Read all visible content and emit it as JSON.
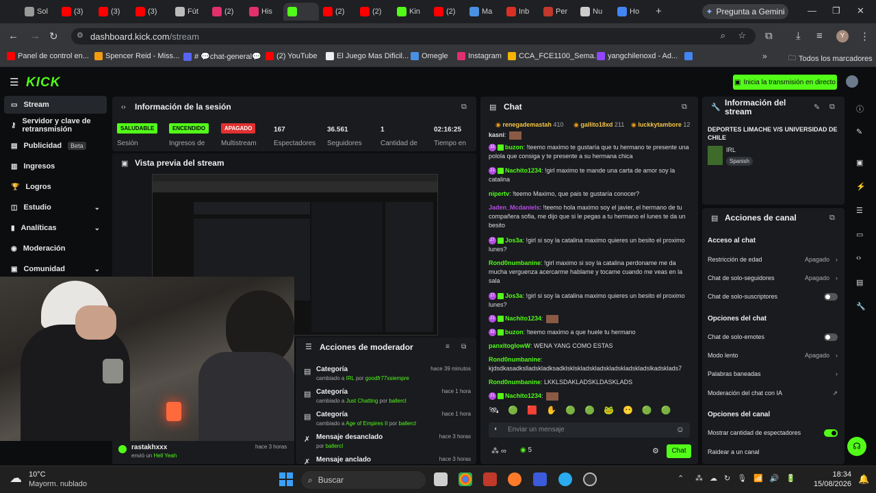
{
  "browser": {
    "tabs": [
      {
        "label": "Sol",
        "color": "#999"
      },
      {
        "label": "(3)",
        "color": "#ff0000"
      },
      {
        "label": "(3)",
        "color": "#ff0000"
      },
      {
        "label": "(3)",
        "color": "#ff0000"
      },
      {
        "label": "Fút",
        "color": "#bbb"
      },
      {
        "label": "(2)",
        "color": "#e1306c"
      },
      {
        "label": "His",
        "color": "#e1306c"
      },
      {
        "label": "",
        "color": "#53fc18"
      },
      {
        "label": "(2)",
        "color": "#ff0000"
      },
      {
        "label": "(2)",
        "color": "#ff0000"
      },
      {
        "label": "Kin",
        "color": "#53fc18"
      },
      {
        "label": "(2)",
        "color": "#ff0000"
      },
      {
        "label": "Ma",
        "color": "#4a90e2"
      },
      {
        "label": "Inb",
        "color": "#d93025"
      },
      {
        "label": "Per",
        "color": "#c0392b"
      },
      {
        "label": "Nu",
        "color": "#ccc"
      },
      {
        "label": "Ho",
        "color": "#4285f4"
      }
    ],
    "gemini": "Pregunta a Gemini",
    "url_host": "dashboard.kick.com",
    "url_path": "/stream",
    "avatar": "Y",
    "bookmarks": [
      {
        "label": "Panel de control en...",
        "color": "#ff0000"
      },
      {
        "label": "Spencer Reid - Miss...",
        "color": "#f39c12"
      },
      {
        "label": "# 💬chat-general💬",
        "color": "#5865f2"
      },
      {
        "label": "(2) YouTube",
        "color": "#ff0000"
      },
      {
        "label": "El Juego Mas Dificil...",
        "color": "#eee"
      },
      {
        "label": "Omegle",
        "color": "#4a90e2"
      },
      {
        "label": "Instagram",
        "color": "#e1306c"
      },
      {
        "label": "CCA_FCE1100_Sema...",
        "color": "#f4b400"
      },
      {
        "label": "yangchilenoxd - Ad...",
        "color": "#9146ff"
      },
      {
        "label": "",
        "color": "#4285f4"
      }
    ],
    "all_bookmarks": "Todos los marcadores"
  },
  "kick": {
    "logo": "KICK",
    "go_live": "Inicia la transmisión en directo",
    "sidebar": [
      {
        "label": "Stream",
        "active": true
      },
      {
        "label": "Servidor y clave de retransmisión"
      },
      {
        "label": "Publicidad",
        "beta": "Beta"
      },
      {
        "label": "Ingresos"
      },
      {
        "label": "Logros"
      },
      {
        "label": "Estudio",
        "chev": true
      },
      {
        "label": "Analíticas",
        "chev": true
      },
      {
        "label": "Moderación"
      },
      {
        "label": "Comunidad",
        "chev": true
      }
    ],
    "session": {
      "title": "Información de la sesión",
      "badges": [
        {
          "text": "SALUDABLE",
          "label": "Sesión",
          "color": "#53fc18",
          "fg": "#0b0d0f"
        },
        {
          "text": "ENCENDIDO",
          "label": "Ingresos de",
          "color": "#53fc18",
          "fg": "#0b0d0f"
        },
        {
          "text": "APAGADO",
          "label": "Multistream",
          "color": "#e03131",
          "fg": "#ffffff"
        }
      ],
      "stats": [
        {
          "value": "167",
          "label": "Espectadores"
        },
        {
          "value": "36.561",
          "label": "Seguidores"
        },
        {
          "value": "1",
          "label": "Cantidad de"
        },
        {
          "value": "02:16:25",
          "label": "Tiempo en"
        }
      ]
    },
    "preview_title": "Vista previa del stream",
    "cam_alert": {
      "user": "rastakhxxx",
      "action": "envió un",
      "item": "Hell Yeah",
      "time": "hace 3 horas"
    },
    "mod": {
      "title": "Acciones de moderador",
      "rows": [
        {
          "title": "Categoría",
          "pre": "cambiado a",
          "target": "IRL",
          "by": "por",
          "user": "goodfr77xsiempre",
          "time": "hace 39 minutos"
        },
        {
          "title": "Categoría",
          "pre": "cambiado a",
          "target": "Just Chatting",
          "by": "por",
          "user": "ballercl",
          "time": "hace 1 hora"
        },
        {
          "title": "Categoría",
          "pre": "cambiado a",
          "target": "Age of Empires II",
          "by": "por",
          "user": "ballercl",
          "time": "hace 1 hora"
        },
        {
          "title": "Mensaje desanclado",
          "pre": "",
          "target": "",
          "by": "por",
          "user": "ballercl",
          "time": "hace 3 horas"
        },
        {
          "title": "Mensaje anclado",
          "pre": "",
          "target": "",
          "by": "",
          "user": "",
          "time": "hace 3 horas"
        }
      ]
    },
    "chat": {
      "title": "Chat",
      "top": [
        {
          "user": "renegademastah",
          "n": "410"
        },
        {
          "user": "gallito18xd",
          "n": "211"
        },
        {
          "user": "luckkytambore",
          "n": "12"
        }
      ],
      "messages": [
        {
          "user": "kasni",
          "color": "#e0e0e0",
          "text": ""
        },
        {
          "lvl": "32",
          "user": "buzon",
          "color": "#53fc18",
          "text": "!teemo maximo te gustaría que tu hermano te presente una polola que consiga y te presente a su hermana chica"
        },
        {
          "lvl": "21",
          "user": "Nachito1234",
          "color": "#53fc18",
          "text": "!girl maximo te mande una carta de amor soy la catalina"
        },
        {
          "user": "nipertv",
          "color": "#53fc18",
          "text": "!teemo Maximo, que pais te gustaría conocer?"
        },
        {
          "user": "Jaden_Mcdaniels",
          "color": "#b44de0",
          "text": "!teemo hola maximo soy el javier, el hermano de tu compañera sofia, me dijo que si le pegas a tu hermano el lunes te da un besito"
        },
        {
          "lvl": "27",
          "user": "Jos3a",
          "color": "#53fc18",
          "text": "!girl si soy la catalina maximo quieres un besito el proximo lunes?"
        },
        {
          "user": "Rond0numbanine",
          "color": "#53fc18",
          "text": "!girl maximo si soy la catalina perdoname me da mucha verguenza acercarme hablame y tocame cuando me veas en la sala"
        },
        {
          "lvl": "27",
          "user": "Jos3a",
          "color": "#53fc18",
          "text": "!girl si soy la catalina maximo quieres un besito el proximo lunes?"
        },
        {
          "lvl": "21",
          "user": "Nachito1234",
          "color": "#53fc18",
          "text": ""
        },
        {
          "lvl": "32",
          "user": "buzon",
          "color": "#53fc18",
          "text": "!teemo maximo a que huele tu hermano"
        },
        {
          "user": "panxitoglowW",
          "color": "#53fc18",
          "text": "WENA YANG COMO ESTAS"
        },
        {
          "user": "Rond0numbanine",
          "color": "#53fc18",
          "text": "kjdsdkasadkslladskladksadklsklskladskladskladskladskladslkadsklads7"
        },
        {
          "user": "Rond0numbanine",
          "color": "#53fc18",
          "text": "LKKLSDAKLADSKLDASKLADS"
        },
        {
          "lvl": "21",
          "user": "Nachito1234",
          "color": "#53fc18",
          "text": ""
        }
      ],
      "input_placeholder": "Enviar un mensaje",
      "count": "5",
      "send": "Chat"
    },
    "stream_info": {
      "title": "Información del stream",
      "stream_title": "DEPORTES LIMACHE V/S UNIVERSIDAD DE CHILE",
      "category": "IRL",
      "language": "Spanish"
    },
    "channel_actions": {
      "title": "Acciones de canal",
      "chat_access": "Acceso al chat",
      "age": {
        "label": "Restricción de edad",
        "value": "Apagado"
      },
      "followers": {
        "label": "Chat de solo-seguidores",
        "value": "Apagado"
      },
      "subs": {
        "label": "Chat de solo-suscriptores"
      },
      "chat_options": "Opciones del chat",
      "emotes": {
        "label": "Chat de solo-emotes"
      },
      "slow": {
        "label": "Modo lento",
        "value": "Apagado"
      },
      "banned": {
        "label": "Palabras baneadas"
      },
      "ai": {
        "label": "Moderación del chat con IA"
      },
      "channel_options": "Opciones del canal",
      "viewers": {
        "label": "Mostrar cantidad de espectadores"
      },
      "raid": {
        "label": "Raidear a un canal"
      }
    }
  },
  "taskbar": {
    "temp": "10°C",
    "weather": "Mayorm. nublado",
    "search": "Buscar",
    "time": "18:34",
    "date": "15/08/2026"
  }
}
